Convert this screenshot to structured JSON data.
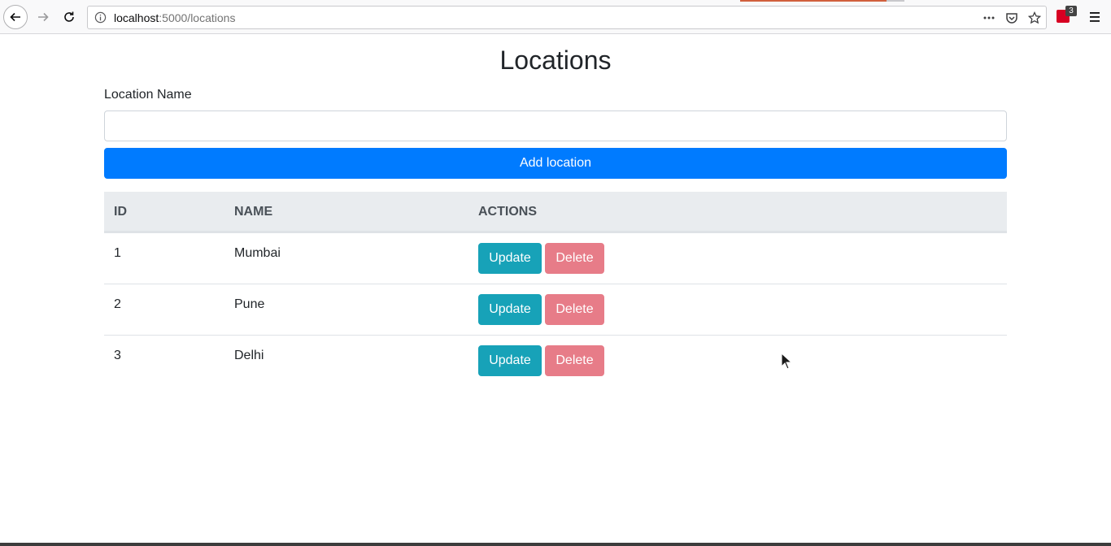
{
  "browser": {
    "url_host": "localhost",
    "url_rest": ":5000/locations",
    "extension_badge": "3"
  },
  "page": {
    "title": "Locations",
    "form": {
      "label": "Location Name",
      "input_value": "",
      "submit_label": "Add location"
    },
    "table": {
      "headers": [
        "ID",
        "NAME",
        "ACTIONS"
      ],
      "rows": [
        {
          "id": "1",
          "name": "Mumbai",
          "update": "Update",
          "delete": "Delete"
        },
        {
          "id": "2",
          "name": "Pune",
          "update": "Update",
          "delete": "Delete"
        },
        {
          "id": "3",
          "name": "Delhi",
          "update": "Update",
          "delete": "Delete"
        }
      ]
    }
  },
  "colors": {
    "primary": "#007bff",
    "info": "#17a2b8",
    "danger_faded": "#e77c88",
    "table_header_bg": "#e9ecef"
  }
}
